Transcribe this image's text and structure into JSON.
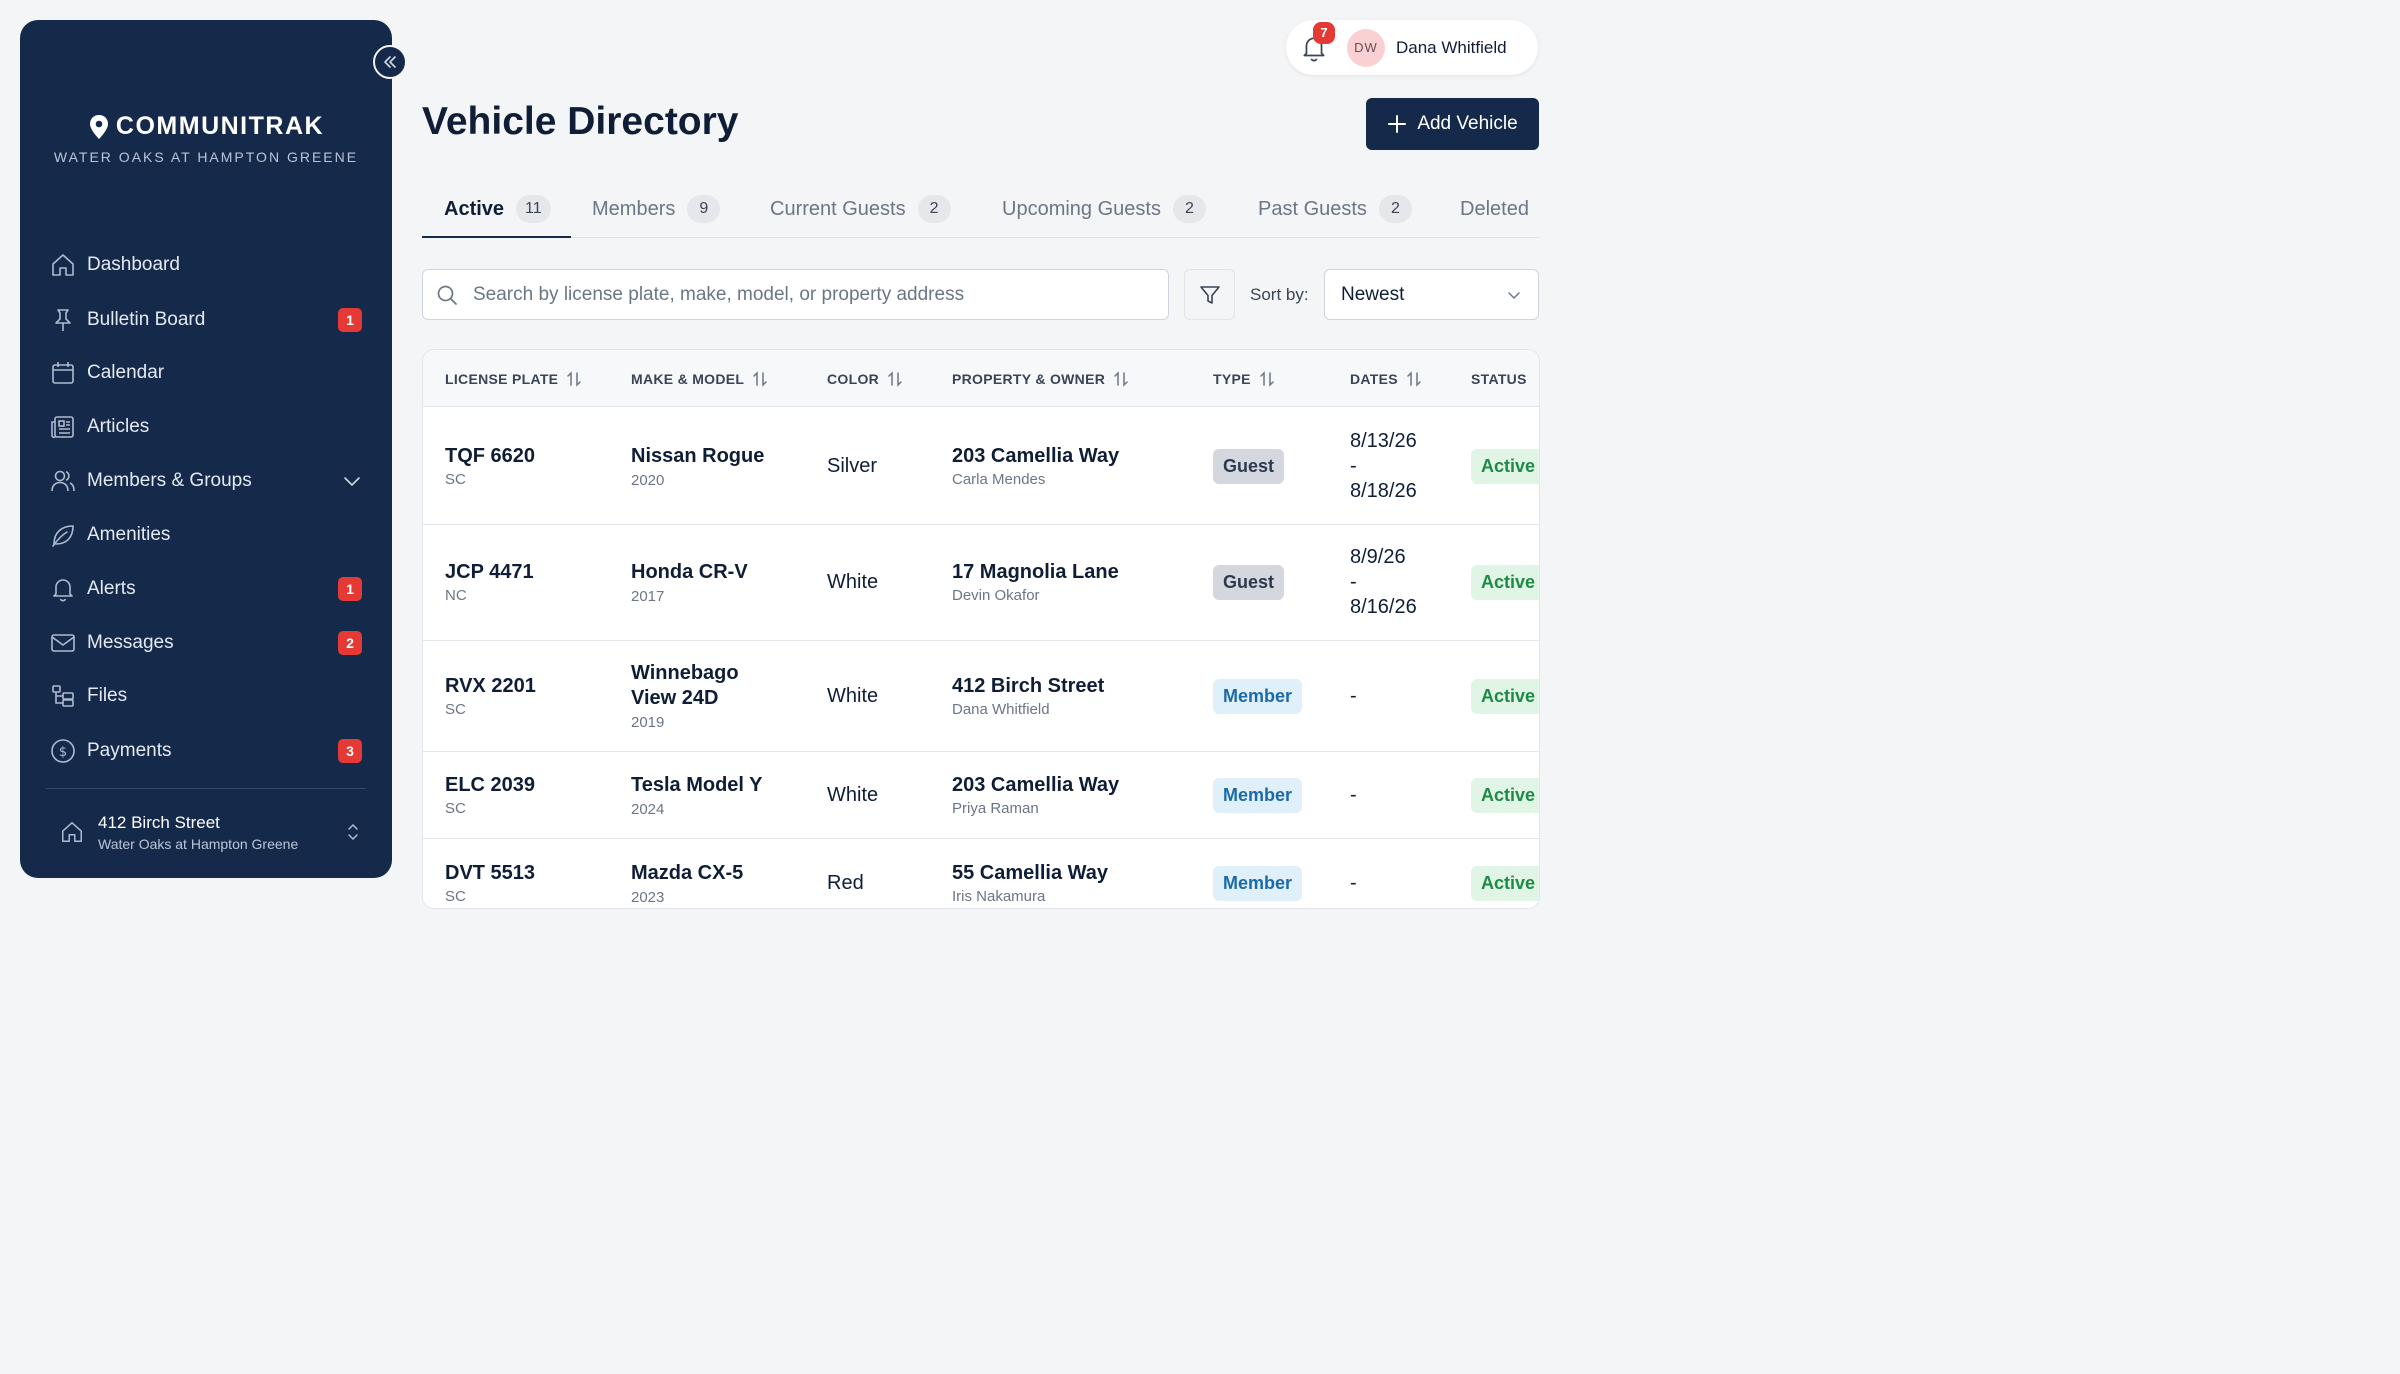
{
  "brand": {
    "name": "COMMUNITRAK",
    "community": "WATER OAKS AT HAMPTON GREENE"
  },
  "sidebar": {
    "items": [
      {
        "label": "Dashboard",
        "icon": "home-icon",
        "badge": ""
      },
      {
        "label": "Bulletin Board",
        "icon": "pin-icon",
        "badge": "1"
      },
      {
        "label": "Calendar",
        "icon": "calendar-icon",
        "badge": ""
      },
      {
        "label": "Articles",
        "icon": "newspaper-icon",
        "badge": ""
      },
      {
        "label": "Members & Groups",
        "icon": "users-icon",
        "badge": ""
      },
      {
        "label": "Amenities",
        "icon": "leaf-icon",
        "badge": ""
      },
      {
        "label": "Alerts",
        "icon": "bell-icon",
        "badge": "1"
      },
      {
        "label": "Messages",
        "icon": "mail-icon",
        "badge": "2"
      },
      {
        "label": "Files",
        "icon": "folder-tree-icon",
        "badge": ""
      },
      {
        "label": "Payments",
        "icon": "dollar-icon",
        "badge": "3"
      }
    ],
    "property": {
      "name": "412 Birch Street",
      "community": "Water Oaks at Hampton Greene"
    }
  },
  "header": {
    "notifications": "7",
    "user_initials": "DW",
    "user_name": "Dana Whitfield"
  },
  "page": {
    "title": "Vehicle Directory",
    "add_button": "Add Vehicle"
  },
  "tabs": [
    {
      "label": "Active",
      "count": "11"
    },
    {
      "label": "Members",
      "count": "9"
    },
    {
      "label": "Current Guests",
      "count": "2"
    },
    {
      "label": "Upcoming Guests",
      "count": "2"
    },
    {
      "label": "Past Guests",
      "count": "2"
    },
    {
      "label": "Deleted",
      "count": ""
    }
  ],
  "search": {
    "placeholder": "Search by license plate, make, model, or property address",
    "value": ""
  },
  "sort": {
    "label": "Sort by:",
    "value": "Newest"
  },
  "table": {
    "headers": [
      "LICENSE PLATE",
      "MAKE & MODEL",
      "COLOR",
      "PROPERTY & OWNER",
      "TYPE",
      "DATES",
      "STATUS"
    ],
    "rows": [
      {
        "plate": "TQF 6620",
        "state": "SC",
        "model": "Nissan Rogue",
        "year": "2020",
        "color": "Silver",
        "address": "203 Camellia Way",
        "owner": "Carla Mendes",
        "type": "Guest",
        "date_from": "8/13/26",
        "date_sep": "-",
        "date_to": "8/18/26",
        "status": "Active"
      },
      {
        "plate": "JCP 4471",
        "state": "NC",
        "model": "Honda CR-V",
        "year": "2017",
        "color": "White",
        "address": "17 Magnolia Lane",
        "owner": "Devin Okafor",
        "type": "Guest",
        "date_from": "8/9/26",
        "date_sep": "-",
        "date_to": "8/16/26",
        "status": "Active"
      },
      {
        "plate": "RVX 2201",
        "state": "SC",
        "model": "Winnebago View 24D",
        "year": "2019",
        "color": "White",
        "address": "412 Birch Street",
        "owner": "Dana Whitfield",
        "type": "Member",
        "date_from": "-",
        "date_sep": "",
        "date_to": "",
        "status": "Active"
      },
      {
        "plate": "ELC 2039",
        "state": "SC",
        "model": "Tesla Model Y",
        "year": "2024",
        "color": "White",
        "address": "203 Camellia Way",
        "owner": "Priya Raman",
        "type": "Member",
        "date_from": "-",
        "date_sep": "",
        "date_to": "",
        "status": "Active"
      },
      {
        "plate": "DVT 5513",
        "state": "SC",
        "model": "Mazda CX-5",
        "year": "2023",
        "color": "Red",
        "address": "55 Camellia Way",
        "owner": "Iris Nakamura",
        "type": "Member",
        "date_from": "-",
        "date_sep": "",
        "date_to": "",
        "status": "Active"
      }
    ]
  }
}
